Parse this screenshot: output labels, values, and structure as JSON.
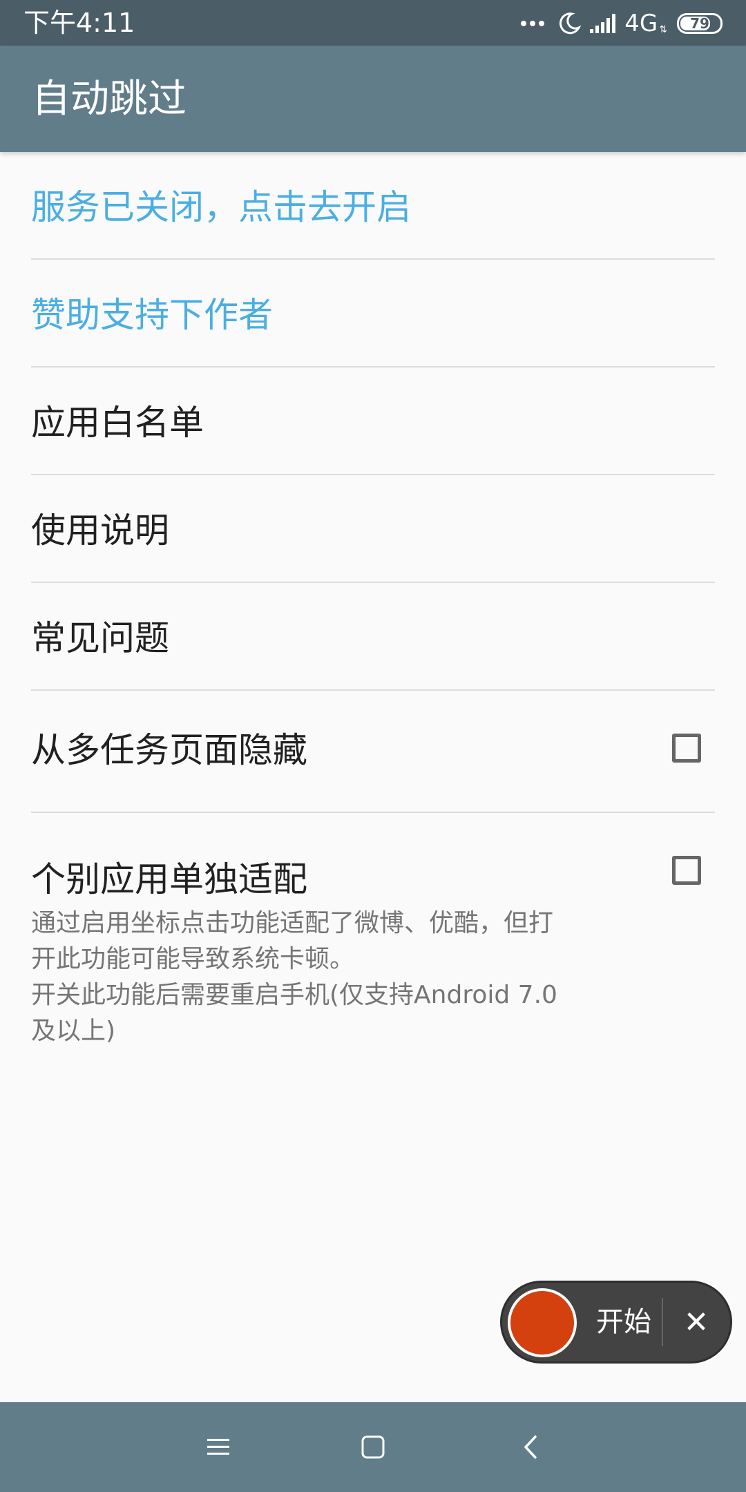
{
  "status_bar": {
    "time": "下午4:11",
    "network": "4G",
    "battery": "79",
    "battery_level_percent": 79
  },
  "app_bar": {
    "title": "自动跳过"
  },
  "list": {
    "service": "服务已关闭，点击去开启",
    "sponsor": "赞助支持下作者",
    "whitelist": "应用白名单",
    "instructions": "使用说明",
    "faq": "常见问题",
    "hide_recents": "从多任务页面隐藏",
    "hide_recents_checked": false,
    "per_app": "个别应用单独适配",
    "per_app_checked": false,
    "per_app_desc_1": "通过启用坐标点击功能适配了微博、优酷，但打",
    "per_app_desc_2": "开此功能可能导致系统卡顿。",
    "per_app_desc_3": "开关此功能后需要重启手机(仅支持Android 7.0",
    "per_app_desc_4": "及以上)"
  },
  "floating_control": {
    "start_label": "开始",
    "close_label": "✕"
  },
  "colors": {
    "status_bar": "#4b5d67",
    "app_bar": "#617d8a",
    "accent_text": "#4aaee3",
    "record_button": "#d5400f"
  },
  "icons": {
    "moon": "moon-icon",
    "signal": "signal-icon",
    "menu": "menu-icon",
    "home": "home-icon",
    "back": "back-icon"
  }
}
